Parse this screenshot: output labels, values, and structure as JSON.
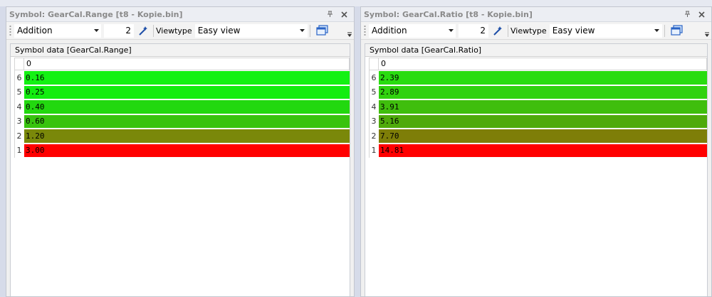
{
  "panels": [
    {
      "title": "Symbol: GearCal.Range [t8 - Kopie.bin]",
      "mode": "Addition",
      "amount": "2",
      "viewtype_label": "Viewtype",
      "viewtype": "Easy view",
      "symbol_data_title": "Symbol data [GearCal.Range]",
      "column_header": "0",
      "rows": [
        {
          "index": "6",
          "value": "0.16",
          "color": "#13f113"
        },
        {
          "index": "5",
          "value": "0.25",
          "color": "#13ed10"
        },
        {
          "index": "4",
          "value": "0.40",
          "color": "#22d80f"
        },
        {
          "index": "3",
          "value": "0.60",
          "color": "#38c30e"
        },
        {
          "index": "2",
          "value": "1.20",
          "color": "#7a880a"
        },
        {
          "index": "1",
          "value": "3.00",
          "color": "#ff0000"
        }
      ]
    },
    {
      "title": "Symbol: GearCal.Ratio [t8 - Kopie.bin]",
      "mode": "Addition",
      "amount": "2",
      "viewtype_label": "Viewtype",
      "viewtype": "Easy view",
      "symbol_data_title": "Symbol data [GearCal.Ratio]",
      "column_header": "0",
      "rows": [
        {
          "index": "6",
          "value": "2.39",
          "color": "#29dc10"
        },
        {
          "index": "5",
          "value": "2.89",
          "color": "#30d20f"
        },
        {
          "index": "4",
          "value": "3.91",
          "color": "#3fbe0d"
        },
        {
          "index": "3",
          "value": "5.16",
          "color": "#4faa0b"
        },
        {
          "index": "2",
          "value": "7.70",
          "color": "#7e7e08"
        },
        {
          "index": "1",
          "value": "14.81",
          "color": "#ff0000"
        }
      ]
    }
  ]
}
